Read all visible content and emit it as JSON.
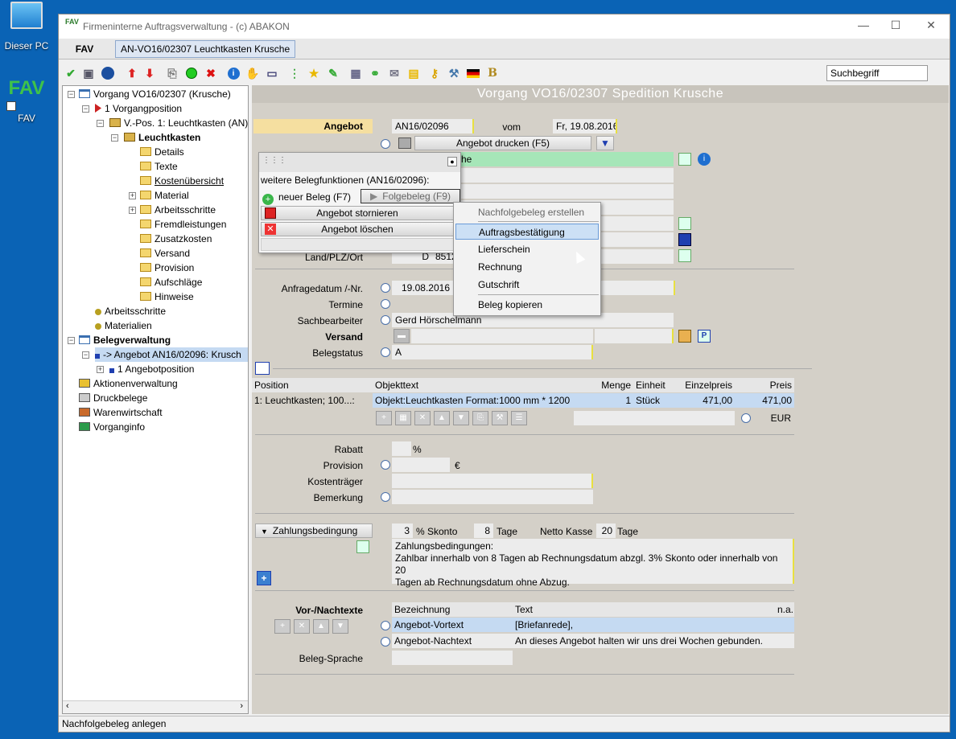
{
  "desktop": {
    "icon1_label": "Dieser PC",
    "icon2_logo": "FAV",
    "icon2_label": "FAV"
  },
  "window": {
    "title": "Firmeninterne Auftragsverwaltung - (c) ABAKON",
    "app_icon": "FAV",
    "minimize": "—",
    "maximize": "☐",
    "close": "✕"
  },
  "tabs": {
    "fav": "FAV",
    "document": "AN-VO16/02307 Leuchtkasten Krusche"
  },
  "toolbar": {
    "search_value": "Suchbegriff"
  },
  "tree": {
    "root": "Vorgang VO16/02307 (Krusche)",
    "vorgangposition": "1 Vorgangposition",
    "vpos": "V.-Pos. 1: Leuchtkasten (AN)",
    "leuchtkasten": "Leuchtkasten",
    "children": [
      "Details",
      "Texte",
      "Kostenübersicht",
      "Material",
      "Arbeitsschritte",
      "Fremdleistungen",
      "Zusatzkosten",
      "Versand",
      "Provision",
      "Aufschläge",
      "Hinweise"
    ],
    "arbeitsschritte": "Arbeitsschritte",
    "materialien": "Materialien",
    "belegverwaltung": "Belegverwaltung",
    "angebot": "-> Angebot AN16/02096: Krusch",
    "angebotposition": "1 Angebotposition",
    "aktionen": "Aktionenverwaltung",
    "druckbelege": "Druckbelege",
    "warenwirtschaft": "Warenwirtschaft",
    "vorganginfo": "Vorganginfo"
  },
  "main": {
    "header": "Vorgang VO16/02307 Spedition Krusche",
    "angebot_label": "Angebot",
    "angebot_nr": "AN16/02096",
    "vom_label": "vom",
    "vom_value": "Fr, 19.08.2016",
    "print_button": "Angebot drucken (F5)",
    "kunde_value": "he",
    "land_label": "Land/PLZ/Ort",
    "land_value": "D",
    "plz_value": "8512",
    "anfrage_label": "Anfragedatum /-Nr.",
    "anfrage_value": "19.08.2016",
    "termine_label": "Termine",
    "sachbearbeiter_label": "Sachbearbeiter",
    "sachbearbeiter_value": "Gerd Hörschelmann",
    "versand_label": "Versand",
    "belegstatus_label": "Belegstatus",
    "belegstatus_value": "A",
    "grid": {
      "headers": [
        "Position",
        "Objekttext",
        "Menge",
        "Einheit",
        "Einzelpreis",
        "Preis"
      ],
      "row": [
        "1: Leuchtkasten; 100...:",
        "Objekt:Leuchtkasten Format:1000 mm * 1200",
        "1",
        "Stück",
        "471,00",
        "471,00"
      ],
      "currency": "EUR"
    },
    "rabatt_label": "Rabatt",
    "rabatt_unit": "%",
    "provision_label": "Provision",
    "provision_unit": "€",
    "kostentraeger_label": "Kostenträger",
    "bemerkung_label": "Bemerkung",
    "zahlung_button": "Zahlungsbedingung",
    "skonto_value": "3",
    "skonto_label": "% Skonto",
    "tage_value": "8",
    "tage_label": "Tage",
    "netto_label": "Netto Kasse",
    "netto_value": "20",
    "netto_tage": "Tage",
    "zahlung_text_1": "Zahlungsbedingungen:",
    "zahlung_text_2": "Zahlbar innerhalb von 8 Tagen ab Rechnungsdatum abzgl. 3% Skonto oder innerhalb von 20",
    "zahlung_text_3": "Tagen ab Rechnungsdatum ohne Abzug.",
    "texte_label": "Vor-/Nachtexte",
    "texte_headers": [
      "Bezeichnung",
      "Text",
      "n.a."
    ],
    "texte_rows": [
      {
        "bez": "Angebot-Vortext",
        "text": "[Briefanrede],"
      },
      {
        "bez": "Angebot-Nachtext",
        "text": "An dieses Angebot halten wir uns drei Wochen gebunden."
      }
    ],
    "sprache_label": "Beleg-Sprache"
  },
  "popup": {
    "title": "weitere Belegfunktionen (AN16/02096):",
    "neuer_beleg": "neuer Beleg (F7)",
    "folgebeleg": "Folgebeleg (F9)",
    "stornieren": "Angebot stornieren",
    "loeschen": "Angebot löschen"
  },
  "menu": {
    "header": "Nachfolgebeleg erstellen",
    "items": [
      "Auftragsbestätigung",
      "Lieferschein",
      "Rechnung",
      "Gutschrift"
    ],
    "kopieren": "Beleg kopieren"
  },
  "statusbar": "Nachfolgebeleg anlegen",
  "colors": {
    "desktop": "#0a63b5",
    "highlight": "#c5daf2",
    "label_bg": "#f5dfa0",
    "green_field": "#a6e6b8"
  }
}
